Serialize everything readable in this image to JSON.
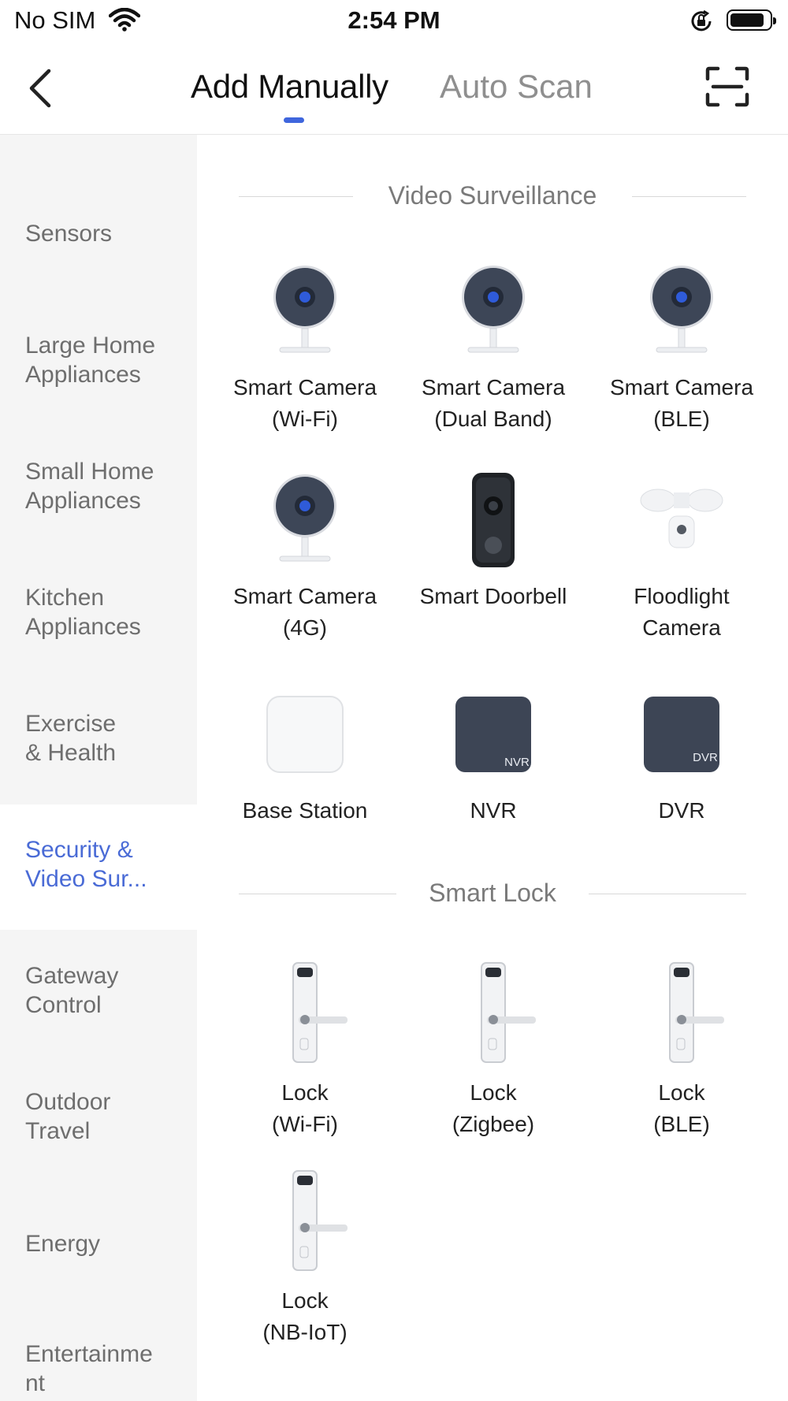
{
  "status_bar": {
    "carrier": "No SIM",
    "time": "2:54 PM"
  },
  "nav": {
    "tabs": [
      {
        "label": "Add Manually",
        "active": true
      },
      {
        "label": "Auto Scan",
        "active": false
      }
    ],
    "accent": "#3f66dd"
  },
  "sidebar": {
    "items": [
      {
        "label": "Sensors"
      },
      {
        "label": "Large Home\nAppliances"
      },
      {
        "label": "Small Home\nAppliances"
      },
      {
        "label": "Kitchen\nAppliances"
      },
      {
        "label": "Exercise\n& Health"
      },
      {
        "label": "Security &\nVideo Sur...",
        "active": true
      },
      {
        "label": "Gateway\nControl"
      },
      {
        "label": "Outdoor\nTravel"
      },
      {
        "label": "Energy"
      },
      {
        "label": "Entertainme\nnt"
      }
    ],
    "active_color": "#4a6bd6"
  },
  "sections": [
    {
      "title": "Video Surveillance",
      "devices": [
        {
          "name": "Smart Camera\n(Wi-Fi)",
          "icon": "camera-icon"
        },
        {
          "name": "Smart Camera\n(Dual Band)",
          "icon": "camera-icon"
        },
        {
          "name": "Smart Camera\n(BLE)",
          "icon": "camera-icon"
        },
        {
          "name": "Smart Camera\n(4G)",
          "icon": "camera-icon"
        },
        {
          "name": "Smart Doorbell",
          "icon": "doorbell-icon"
        },
        {
          "name": "Floodlight\nCamera",
          "icon": "floodlight-camera-icon"
        },
        {
          "name": "Base Station",
          "icon": "base-station-icon"
        },
        {
          "name": "NVR",
          "icon": "nvr-icon",
          "badge": "NVR"
        },
        {
          "name": "DVR",
          "icon": "dvr-icon",
          "badge": "DVR"
        }
      ]
    },
    {
      "title": "Smart Lock",
      "devices": [
        {
          "name": "Lock\n(Wi-Fi)",
          "icon": "lock-icon"
        },
        {
          "name": "Lock\n(Zigbee)",
          "icon": "lock-icon"
        },
        {
          "name": "Lock\n(BLE)",
          "icon": "lock-icon"
        },
        {
          "name": "Lock\n(NB-IoT)",
          "icon": "lock-icon"
        }
      ]
    }
  ]
}
